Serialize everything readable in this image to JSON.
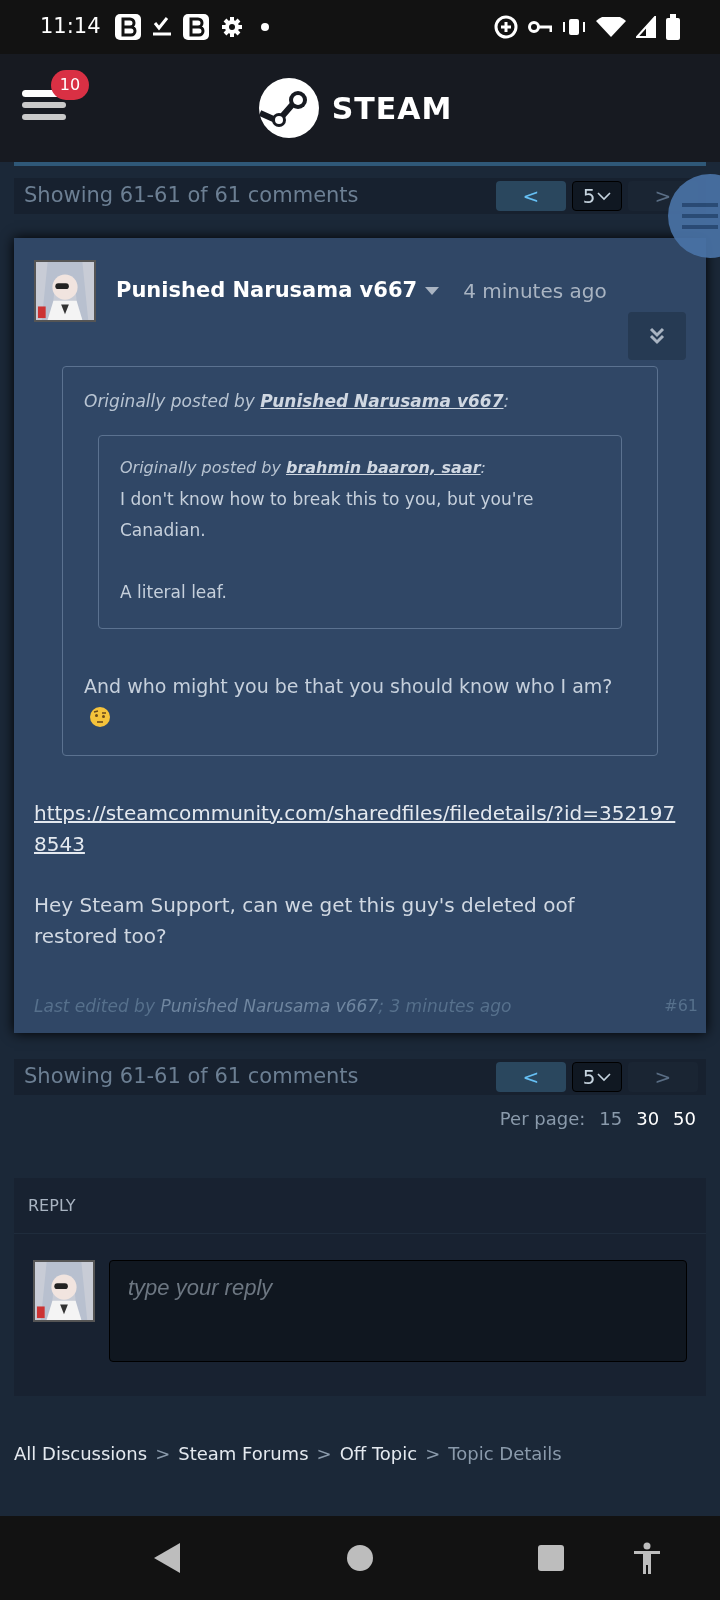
{
  "status_bar": {
    "time": "11:14"
  },
  "header": {
    "notification_count": "10",
    "logo_text": "STEAM"
  },
  "pagination_top": {
    "summary": "Showing 61-61 of 61 comments",
    "prev": {
      "label": "<",
      "disabled": false
    },
    "page": "5",
    "next": {
      "label": ">",
      "disabled": true
    }
  },
  "comment": {
    "author": "Punished Narusama v667",
    "time": "4 minutes ago",
    "quote": {
      "prefix": "Originally posted by",
      "author": "Punished Narusama v667",
      "suffix": ":",
      "inner_quote": {
        "prefix": "Originally posted by",
        "author": "brahmin baaron, saar",
        "suffix": ":",
        "lines": [
          "I don't know how to break this to you, but you're Canadian.",
          "A literal leaf."
        ]
      },
      "reply": "And who might you be that you should know who I am?"
    },
    "link": "https://steamcommunity.com/sharedfiles/filedetails/?id=3521978543",
    "text": "Hey Steam Support, can we get this guy's deleted oof restored too?",
    "edited": {
      "prefix": "Last edited by",
      "author": "Punished Narusama v667",
      "time": "; 3 minutes ago"
    },
    "number": "#61"
  },
  "pagination_bottom": {
    "summary": "Showing 61-61 of 61 comments",
    "prev": {
      "label": "<",
      "disabled": false
    },
    "page": "5",
    "next": {
      "label": ">",
      "disabled": true
    }
  },
  "per_page": {
    "label": "Per page:",
    "options": [
      {
        "label": "15",
        "selected": true
      },
      {
        "label": "30",
        "selected": false
      },
      {
        "label": "50",
        "selected": false
      }
    ]
  },
  "reply": {
    "title": "REPLY",
    "placeholder": "type your reply"
  },
  "breadcrumbs": [
    {
      "label": "All Discussions",
      "current": false
    },
    {
      "label": "Steam Forums",
      "current": false
    },
    {
      "label": "Off Topic",
      "current": false
    },
    {
      "label": "Topic Details",
      "current": true
    }
  ],
  "breadcrumb_separator": ">"
}
